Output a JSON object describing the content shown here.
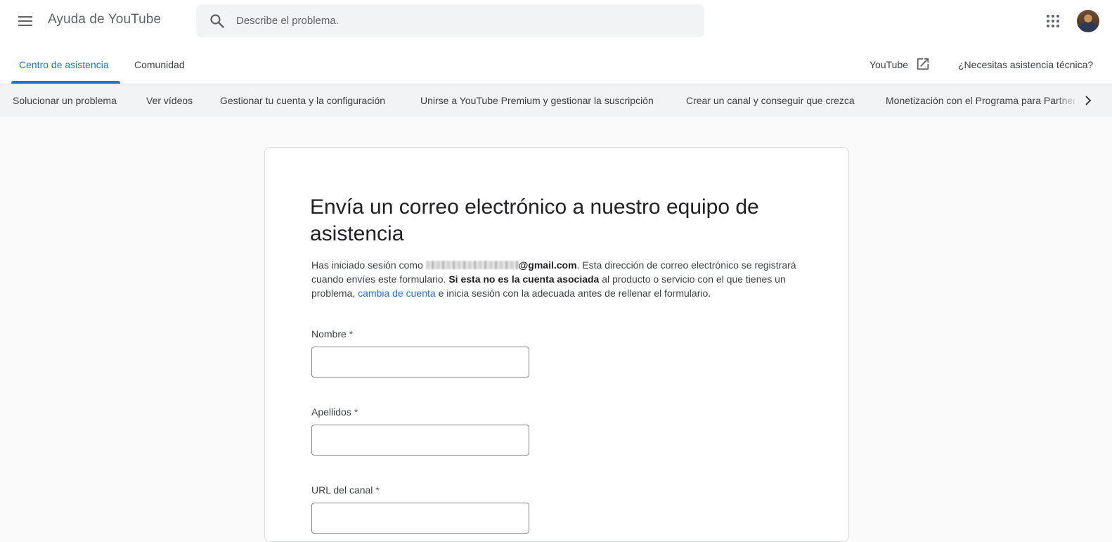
{
  "header": {
    "app_title": "Ayuda de YouTube",
    "search_placeholder": "Describe el problema."
  },
  "tabs": [
    {
      "label": "Centro de asistencia",
      "active": true
    },
    {
      "label": "Comunidad",
      "active": false
    }
  ],
  "header_links": {
    "youtube": "YouTube",
    "support": "¿Necesitas asistencia técnica?"
  },
  "categories": [
    "Solucionar un problema",
    "Ver vídeos",
    "Gestionar tu cuenta y la configuración",
    "Unirse a YouTube Premium y gestionar la suscripción",
    "Crear un canal y conseguir que crezca",
    "Monetización con el Programa para Partners"
  ],
  "form": {
    "title": "Envía un correo electrónico a nuestro equipo de asistencia",
    "desc_1": "Has iniciado sesión como",
    "email_domain": "@gmail.com",
    "desc_2": ". Esta dirección de correo electrónico se registrará cuando envíes este formulario.",
    "desc_bold": "Si esta no es la cuenta asociada",
    "desc_3": " al producto o servicio con el que tienes un problema, ",
    "desc_link": "cambia de cuenta",
    "desc_4": " e inicia sesión con la adecuada antes de rellenar el formulario.",
    "required_mark": "*",
    "fields": [
      {
        "label": "Nombre",
        "value": ""
      },
      {
        "label": "Apellidos",
        "value": ""
      },
      {
        "label": "URL del canal",
        "value": ""
      }
    ]
  },
  "colors": {
    "accent": "#1a73e8",
    "nav_background": "#f1f3f4"
  },
  "icons": [
    "menu-icon",
    "search-icon",
    "apps-grid-icon",
    "external-link-icon",
    "chevron-right-icon"
  ]
}
